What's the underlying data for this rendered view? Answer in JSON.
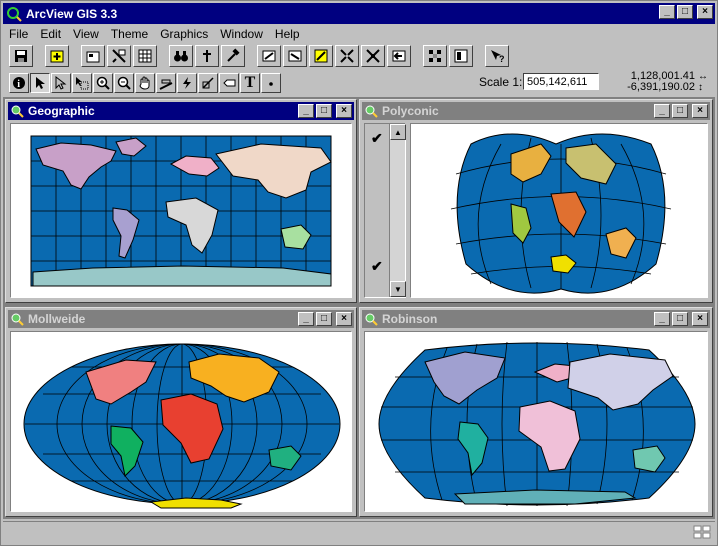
{
  "app": {
    "title": "ArcView GIS 3.3",
    "min": "_",
    "max": "□",
    "close": "×"
  },
  "menus": [
    "File",
    "Edit",
    "View",
    "Theme",
    "Graphics",
    "Window",
    "Help"
  ],
  "scale": {
    "label": "Scale 1:",
    "value": "505,142,611"
  },
  "coords": {
    "x": "1,128,001.41",
    "y": "-6,391,190.02",
    "arrow_x": "↔",
    "arrow_y": "↕"
  },
  "views": {
    "geographic": {
      "title": "Geographic"
    },
    "polyconic": {
      "title": "Polyconic"
    },
    "mollweide": {
      "title": "Mollweide"
    },
    "robinson": {
      "title": "Robinson"
    }
  },
  "toc": {
    "check1": "✔",
    "check2": "✔",
    "up": "▲",
    "down": "▼"
  },
  "tools": {
    "identify": "i",
    "text": "T"
  },
  "colors": {
    "ocean": "#0a6ab0",
    "titlebar": "#000080"
  }
}
